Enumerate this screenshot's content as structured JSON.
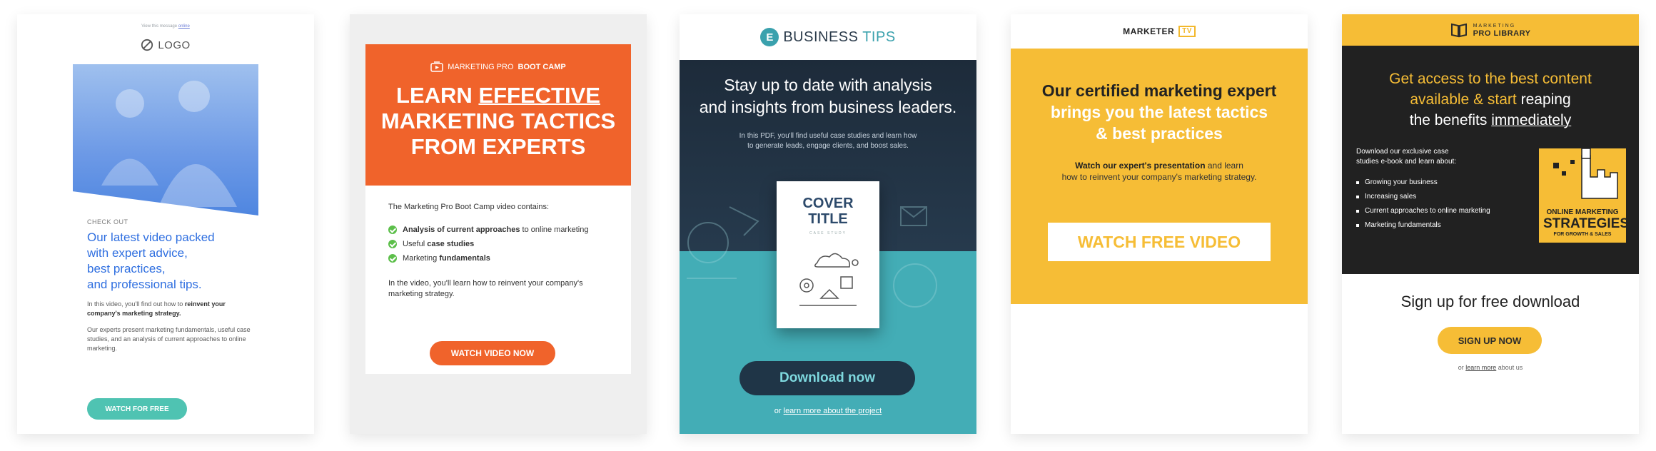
{
  "colors": {
    "blue_accent": "#2f6fe0",
    "teal_button": "#4fc3b2",
    "orange": "#f0632b",
    "navy": "#1d2b3a",
    "teal": "#43adb6",
    "yellow": "#f6bd36",
    "dark": "#212121"
  },
  "card1": {
    "view_text": "View this message",
    "view_link": "online",
    "logo": "LOGO",
    "logo_icon": "circle-slash-icon",
    "eyebrow": "CHECK OUT",
    "headline_1": "Our latest video packed",
    "headline_2": "with expert advice,",
    "headline_3": "best practices,",
    "headline_4": "and professional tips.",
    "para1_a": "In this video, you'll find out how to",
    "para1_b": "reinvent your company's marketing strategy.",
    "para2": "Our experts present marketing fundamentals, useful case studies, and an analysis of current approaches to online marketing.",
    "button": "WATCH FOR FREE"
  },
  "card2": {
    "brand_a": "MARKETING PRO",
    "brand_b": "BOOT CAMP",
    "brand_icon": "video-camera-icon",
    "title_1": "LEARN",
    "title_1u": "EFFECTIVE",
    "title_2": "MARKETING TACTICS",
    "title_3": "FROM EXPERTS",
    "intro": "The Marketing Pro Boot Camp video contains:",
    "items": [
      {
        "bold": "Analysis of current approaches",
        "rest": " to online marketing",
        "bold_first": true
      },
      {
        "bold": "case studies",
        "pre": "Useful ",
        "bold_first": false
      },
      {
        "bold": "fundamentals",
        "pre": "Marketing ",
        "bold_first": false
      }
    ],
    "outro": "In the video, you'll learn how to reinvent your company's marketing strategy.",
    "button": "WATCH VIDEO NOW"
  },
  "card3": {
    "badge": "E",
    "brand_a": "BUSINESS",
    "brand_b": "TIPS",
    "headline_1": "Stay up to date with analysis",
    "headline_2": "and insights from business leaders.",
    "sub_1": "In this PDF, you'll find useful case studies and learn how",
    "sub_2": "to generate leads, engage clients, and boost sales.",
    "cover_title_1": "COVER",
    "cover_title_2": "TITLE",
    "cover_sub": "CASE STUDY",
    "button": "Download now",
    "foot_pre": "or ",
    "foot_link": "learn more about the project"
  },
  "card4": {
    "brand": "MARKETER",
    "brand_tv": "TV",
    "h1": "Our certified marketing expert",
    "h2a": "brings you the latest tactics",
    "h2b": "& best practices",
    "p_bold": "Watch our expert's presentation",
    "p_rest": " and learn",
    "p_2": "how to reinvent your company's marketing strategy.",
    "button": "WATCH FREE VIDEO"
  },
  "card5": {
    "brand_1": "MARKETING",
    "brand_2": "PRO LIBRARY",
    "brand_icon": "open-book-icon",
    "h_1": "Get access to the best content",
    "h_2a": "available & start",
    "h_2b": " reaping",
    "h_3a": "the benefits ",
    "h_3b": "immediately",
    "lt_1": "Download our exclusive case",
    "lt_2": "studies e-book and learn about:",
    "list": [
      "Growing your business",
      "Increasing sales",
      "Current approaches to online marketing",
      "Marketing fundamentals"
    ],
    "book_a": "ONLINE MARKETING",
    "book_b": "STRATEGIES",
    "book_c": "FOR GROWTH & SALES",
    "sign": "Sign up for free download",
    "button": "SIGN UP NOW",
    "foot_pre": "or ",
    "foot_link": "learn more",
    "foot_post": " about us"
  }
}
